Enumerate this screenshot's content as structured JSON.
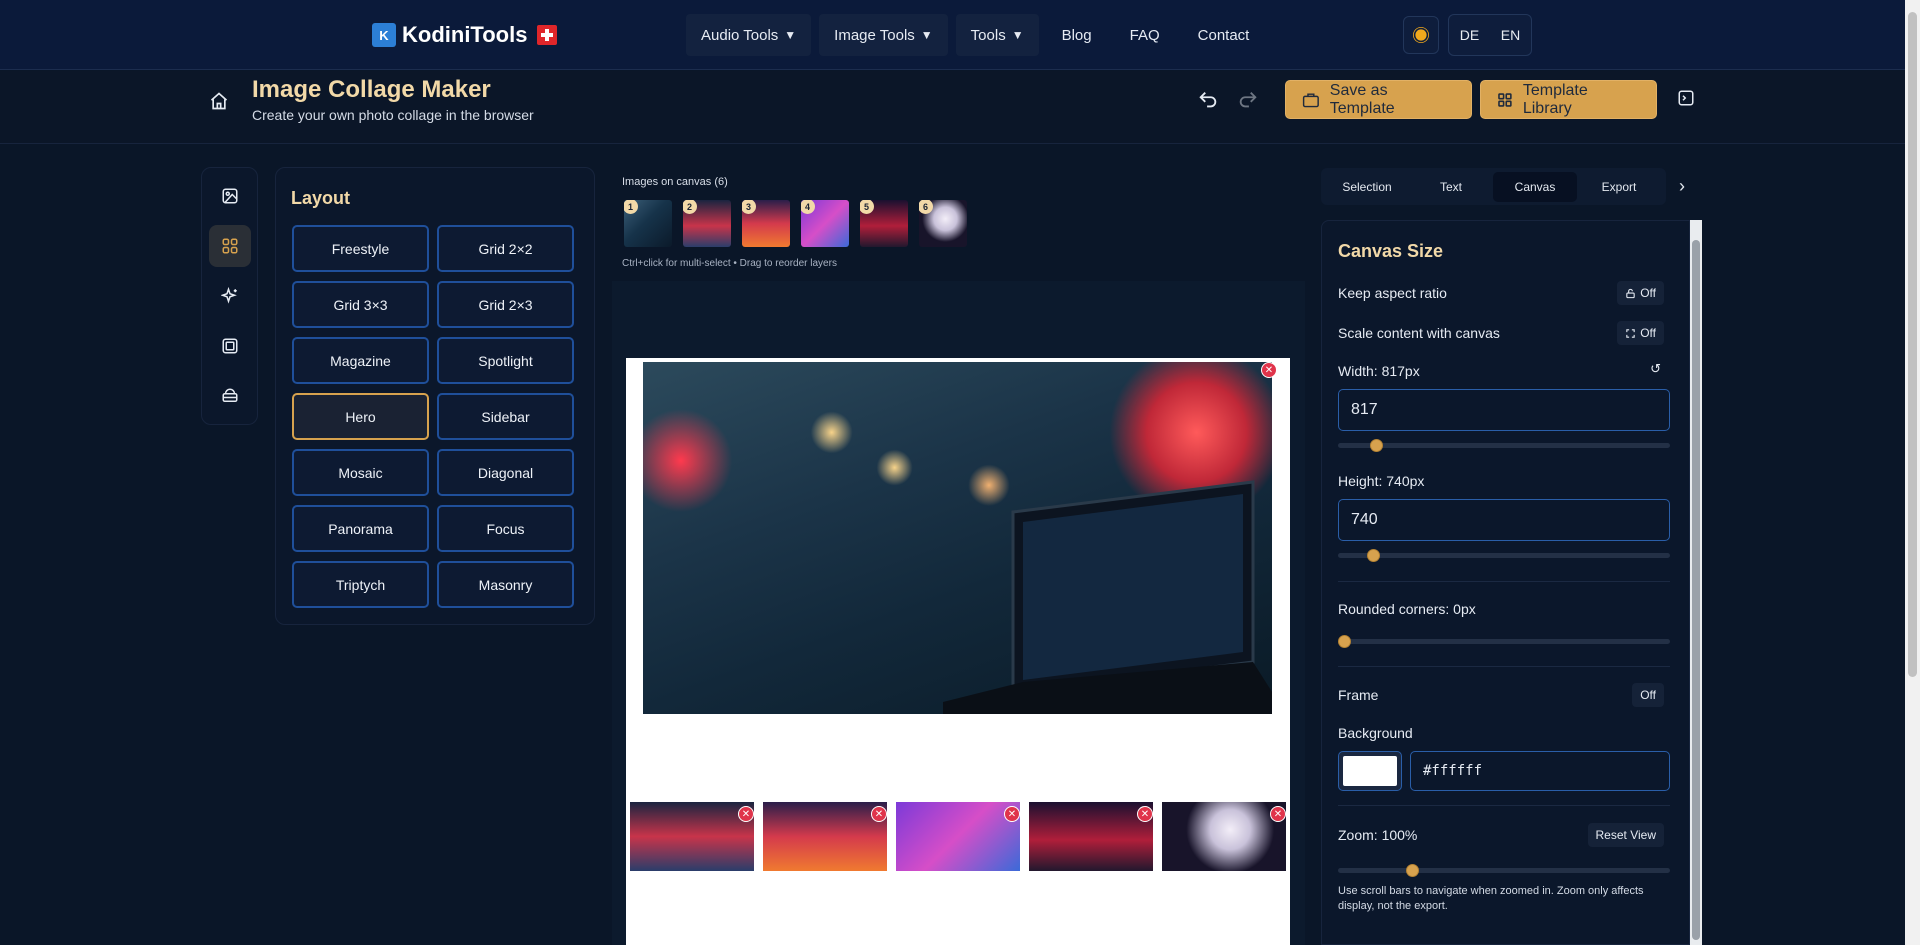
{
  "nav": {
    "logo_text": "KodiniTools",
    "menu": [
      {
        "label": "Audio Tools",
        "dropdown": true
      },
      {
        "label": "Image Tools",
        "dropdown": true
      },
      {
        "label": "Tools",
        "dropdown": true
      },
      {
        "label": "Blog",
        "dropdown": false
      },
      {
        "label": "FAQ",
        "dropdown": false
      },
      {
        "label": "Contact",
        "dropdown": false
      }
    ],
    "lang_de": "DE",
    "lang_en": "EN"
  },
  "header": {
    "title": "Image Collage Maker",
    "subtitle": "Create your own photo collage in the browser",
    "save_template": "Save as Template",
    "template_library": "Template Library"
  },
  "layout_panel": {
    "title": "Layout",
    "options": [
      "Freestyle",
      "Grid 2×2",
      "Grid 3×3",
      "Grid 2×3",
      "Magazine",
      "Spotlight",
      "Hero",
      "Sidebar",
      "Mosaic",
      "Diagonal",
      "Panorama",
      "Focus",
      "Triptych",
      "Masonry"
    ],
    "active": "Hero"
  },
  "canvas_area": {
    "images_label": "Images on canvas (6)",
    "hint": "Ctrl+click for multi-select • Drag to reorder layers",
    "thumb_numbers": [
      "1",
      "2",
      "3",
      "4",
      "5",
      "6"
    ]
  },
  "right_panel": {
    "tabs": [
      "Selection",
      "Text",
      "Canvas",
      "Export"
    ],
    "active_tab": "Canvas",
    "canvas_size_title": "Canvas Size",
    "keep_aspect_label": "Keep aspect ratio",
    "keep_aspect_value": "Off",
    "scale_content_label": "Scale content with canvas",
    "scale_content_value": "Off",
    "width_label": "Width: 817px",
    "width_value": "817",
    "height_label": "Height: 740px",
    "height_value": "740",
    "rounded_label": "Rounded corners: 0px",
    "frame_label": "Frame",
    "frame_value": "Off",
    "background_label": "Background",
    "background_hex": "#ffffff",
    "zoom_label": "Zoom: 100%",
    "reset_view": "Reset View",
    "zoom_help": "Use scroll bars to navigate when zoomed in. Zoom only affects display, not the export."
  }
}
